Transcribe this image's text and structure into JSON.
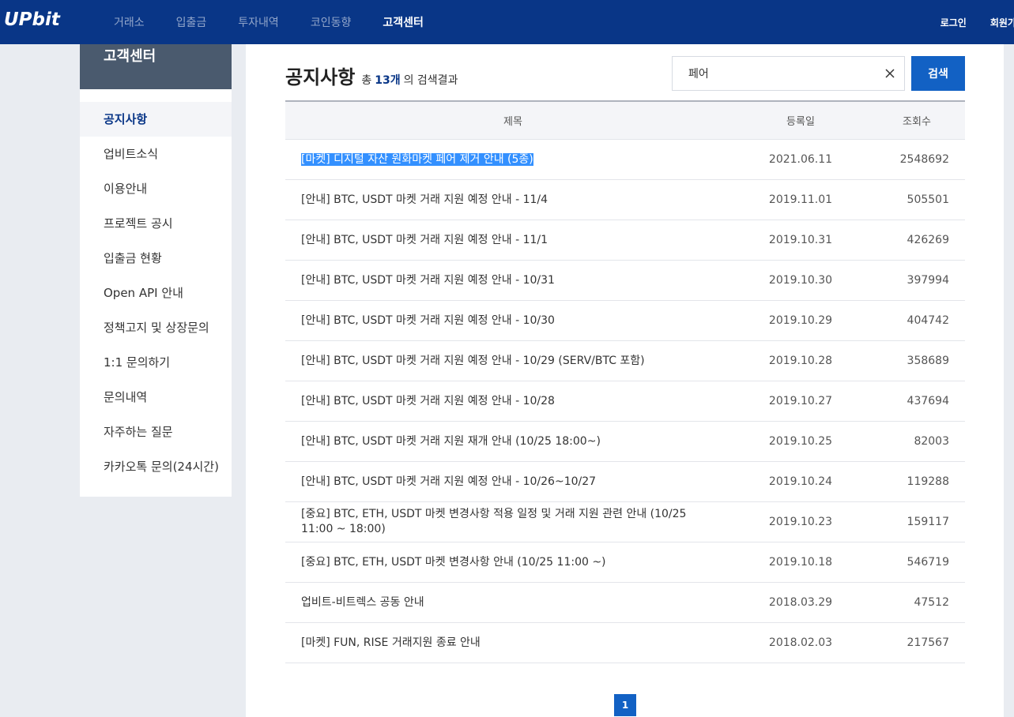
{
  "header": {
    "logo": "UPbit",
    "nav": [
      "거래소",
      "입출금",
      "투자내역",
      "코인동향",
      "고객센터"
    ],
    "login": "로그인",
    "signup": "회원가입"
  },
  "sidebar": {
    "title": "고객센터",
    "items": [
      {
        "label": "공지사항"
      },
      {
        "label": "업비트소식"
      },
      {
        "label": "이용안내"
      },
      {
        "label": "프로젝트 공시"
      },
      {
        "label": "입출금 현황"
      },
      {
        "label": "Open API 안내"
      },
      {
        "label": "정책고지 및 상장문의"
      },
      {
        "label": "1:1 문의하기"
      },
      {
        "label": "문의내역"
      },
      {
        "label": "자주하는 질문"
      },
      {
        "label": "카카오톡 문의(24시간)"
      }
    ]
  },
  "main": {
    "title": "공지사항",
    "result_prefix": "총",
    "result_count": "13개",
    "result_suffix": "의 검색결과",
    "search_value": "페어",
    "search_button": "검색",
    "columns": {
      "title": "제목",
      "date": "등록일",
      "views": "조회수"
    },
    "rows": [
      {
        "title": "[마켓] 디지털 자산 원화마켓 페어 제거 안내 (5종)",
        "date": "2021.06.11",
        "views": "2548692"
      },
      {
        "title": "[안내] BTC, USDT 마켓 거래 지원 예정 안내 - 11/4",
        "date": "2019.11.01",
        "views": "505501"
      },
      {
        "title": "[안내] BTC, USDT 마켓 거래 지원 예정 안내 - 11/1",
        "date": "2019.10.31",
        "views": "426269"
      },
      {
        "title": "[안내] BTC, USDT 마켓 거래 지원 예정 안내 - 10/31",
        "date": "2019.10.30",
        "views": "397994"
      },
      {
        "title": "[안내] BTC, USDT 마켓 거래 지원 예정 안내 - 10/30",
        "date": "2019.10.29",
        "views": "404742"
      },
      {
        "title": "[안내] BTC, USDT 마켓 거래 지원 예정 안내 - 10/29 (SERV/BTC 포함)",
        "date": "2019.10.28",
        "views": "358689"
      },
      {
        "title": "[안내] BTC, USDT 마켓 거래 지원 예정 안내 - 10/28",
        "date": "2019.10.27",
        "views": "437694"
      },
      {
        "title": "[안내] BTC, USDT 마켓 거래 지원 재개 안내 (10/25 18:00~)",
        "date": "2019.10.25",
        "views": "82003"
      },
      {
        "title": "[안내] BTC, USDT 마켓 거래 지원 예정 안내 - 10/26~10/27",
        "date": "2019.10.24",
        "views": "119288"
      },
      {
        "title": "[중요] BTC, ETH, USDT 마켓 변경사항 적용 일정 및 거래 지원 관련 안내 (10/25 11:00 ~ 18:00)",
        "date": "2019.10.23",
        "views": "159117"
      },
      {
        "title": "[중요] BTC, ETH, USDT 마켓 변경사항 안내 (10/25 11:00 ~)",
        "date": "2019.10.18",
        "views": "546719"
      },
      {
        "title": "업비트-비트렉스 공동 안내",
        "date": "2018.03.29",
        "views": "47512"
      },
      {
        "title": "[마켓] FUN, RISE 거래지원 종료 안내",
        "date": "2018.02.03",
        "views": "217567"
      }
    ],
    "page": "1"
  }
}
